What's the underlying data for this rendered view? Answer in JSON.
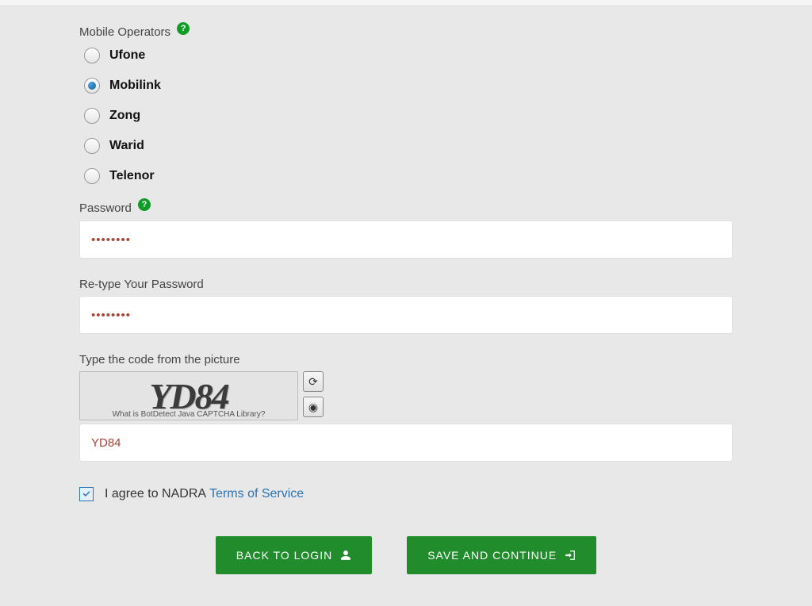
{
  "mobileOperators": {
    "label": "Mobile Operators",
    "options": {
      "0": {
        "label": "Ufone",
        "selected": false
      },
      "1": {
        "label": "Mobilink",
        "selected": true
      },
      "2": {
        "label": "Zong",
        "selected": false
      },
      "3": {
        "label": "Warid",
        "selected": false
      },
      "4": {
        "label": "Telenor",
        "selected": false
      }
    }
  },
  "password": {
    "label": "Password",
    "value": "••••••••"
  },
  "retypePassword": {
    "label": "Re-type Your Password",
    "value": "••••••••"
  },
  "captcha": {
    "label": "Type the code from the picture",
    "imageText": "YD84",
    "footer": "What is BotDetect Java CAPTCHA Library?",
    "input": "YD84"
  },
  "terms": {
    "prefix": "I agree to NADRA",
    "linkText": "Terms of Service",
    "checked": true
  },
  "buttons": {
    "back": "BACK TO LOGIN",
    "save": "SAVE AND CONTINUE"
  },
  "icons": {
    "help": "?",
    "reload": "⟳",
    "sound": "◉"
  }
}
